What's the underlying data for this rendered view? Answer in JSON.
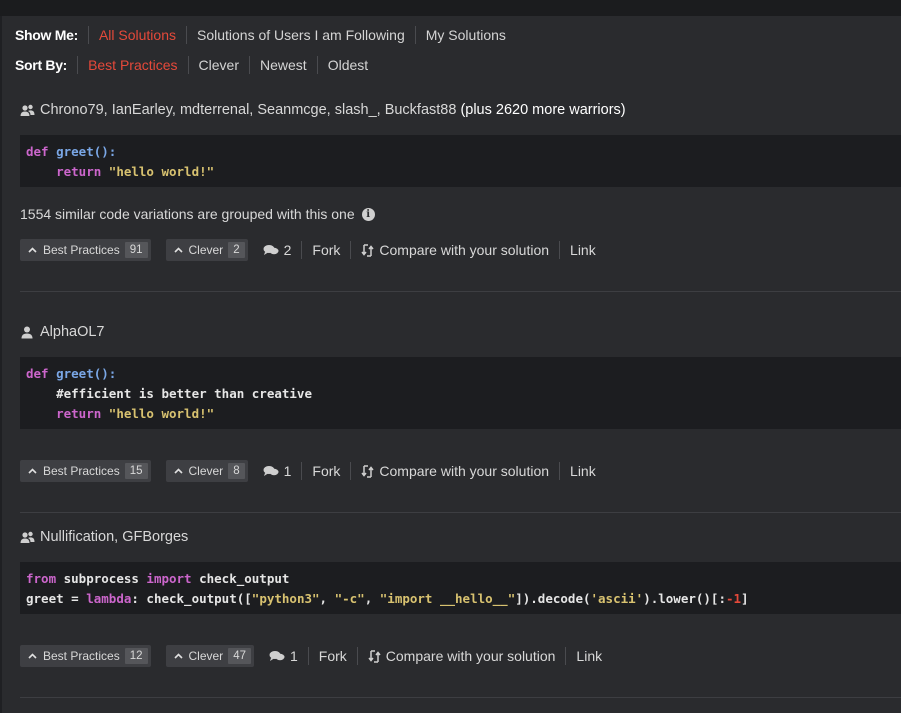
{
  "filters": {
    "show_me": {
      "label": "Show Me:",
      "items": [
        "All Solutions",
        "Solutions of Users I am Following",
        "My Solutions"
      ],
      "active": 0
    },
    "sort_by": {
      "label": "Sort By:",
      "items": [
        "Best Practices",
        "Clever",
        "Newest",
        "Oldest"
      ],
      "active": 0
    }
  },
  "solutions": [
    {
      "icon": "users-icon",
      "authors": "Chrono79, IanEarley, mdterrenal, Seanmcge, slash_, Buckfast88",
      "more": "(plus 2620 more warriors)",
      "code_lines": [
        "def greet():",
        "    return \"hello world!\""
      ],
      "grouped_text": "1554 similar code variations are grouped with this one",
      "best_practices_label": "Best Practices",
      "best_practices_count": "91",
      "clever_label": "Clever",
      "clever_count": "2",
      "comments": "2",
      "fork": "Fork",
      "compare": "Compare with your solution",
      "link": "Link"
    },
    {
      "icon": "user-icon",
      "authors": "AlphaOL7",
      "more": "",
      "code_lines": [
        "def greet():",
        "    #efficient is better than creative",
        "    return \"hello world!\""
      ],
      "grouped_text": "",
      "best_practices_label": "Best Practices",
      "best_practices_count": "15",
      "clever_label": "Clever",
      "clever_count": "8",
      "comments": "1",
      "fork": "Fork",
      "compare": "Compare with your solution",
      "link": "Link"
    },
    {
      "icon": "users-icon",
      "authors": "Nullification, GFBorges",
      "more": "",
      "code_lines": [
        "from subprocess import check_output",
        "greet = lambda: check_output([\"python3\", \"-c\", \"import __hello__\"]).decode('ascii').lower()[:-1]"
      ],
      "grouped_text": "",
      "best_practices_label": "Best Practices",
      "best_practices_count": "12",
      "clever_label": "Clever",
      "clever_count": "47",
      "comments": "1",
      "fork": "Fork",
      "compare": "Compare with your solution",
      "link": "Link"
    }
  ],
  "colors": {
    "accent": "#e5493a",
    "background": "#2a2b2e",
    "code_background": "#1c1d20"
  }
}
